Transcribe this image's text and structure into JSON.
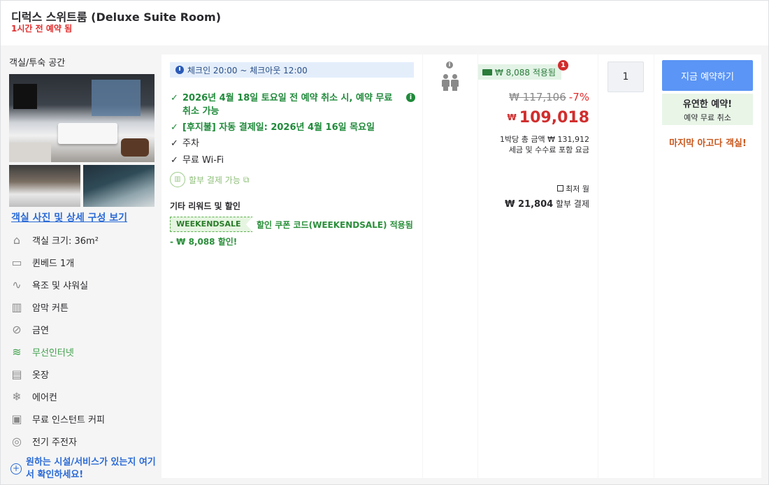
{
  "room": {
    "title": "디럭스 스위트룸 (Deluxe Suite Room)",
    "booked": "1시간 전 예약 됨"
  },
  "left": {
    "section_title": "객실/투숙 공간",
    "photo_link": "객실 사진 및 상세 구성 보기",
    "amenities": [
      {
        "icon": "room-size-icon",
        "label": "객실 크기: 36m²"
      },
      {
        "icon": "bed-icon",
        "label": "퀸베드 1개"
      },
      {
        "icon": "shower-icon",
        "label": "욕조 및 샤워실"
      },
      {
        "icon": "blackout-curtain-icon",
        "label": "암막 커튼"
      },
      {
        "icon": "no-smoking-icon",
        "label": "금연"
      },
      {
        "icon": "wifi-icon",
        "label": "무선인터넷"
      },
      {
        "icon": "wardrobe-icon",
        "label": "옷장"
      },
      {
        "icon": "air-conditioner-icon",
        "label": "에어컨"
      },
      {
        "icon": "coffee-maker-icon",
        "label": "무료 인스턴트 커피"
      },
      {
        "icon": "ev-charger-icon",
        "label": "전기 주전자"
      }
    ],
    "wish_text": "원하는 시설/서비스가 있는지 여기서 확인하세요!"
  },
  "features": {
    "checkin": "체크인 20:00 ~ 체크아웃 12:00",
    "items": [
      "2026년 4월 18일 토요일 전 예약 취소 시, 예약 무료 취소 가능",
      "[후지불] 자동 결제일: 2026년 4월 16일 목요일",
      "주차",
      "무료 Wi-Fi"
    ],
    "installment": "할부 결제 가능",
    "rewards_title": "기타 리워드 및 할인",
    "coupon_code": "WEEKENDSALE",
    "coupon_text": "할인 쿠폰 코드(WEEKENDSALE) 적용됨",
    "discount": "- ₩ 8,088 할인!"
  },
  "price": {
    "applied": "₩ 8,088 적용됨",
    "applied_count": "1",
    "original": "₩ 117,106",
    "percent": "-7%",
    "currency": "₩",
    "amount": "109,018",
    "total_line1": "1박당 총 금액 ₩ 131,912",
    "total_line2": "세금 및 수수료 포함 요금",
    "min_month": "최저 월",
    "installment_amount": "₩ 21,804",
    "installment_suffix": "할부 결제"
  },
  "quantity": "1",
  "booking": {
    "button": "지금 예약하기",
    "flex_title": "유연한 예약!",
    "flex_sub": "예약 무료 취소",
    "last_room": "마지막 아고다 객실!"
  },
  "colors": {
    "accent_blue": "#5b95f5",
    "green": "#1f8a3a",
    "red": "#d12d2d"
  }
}
